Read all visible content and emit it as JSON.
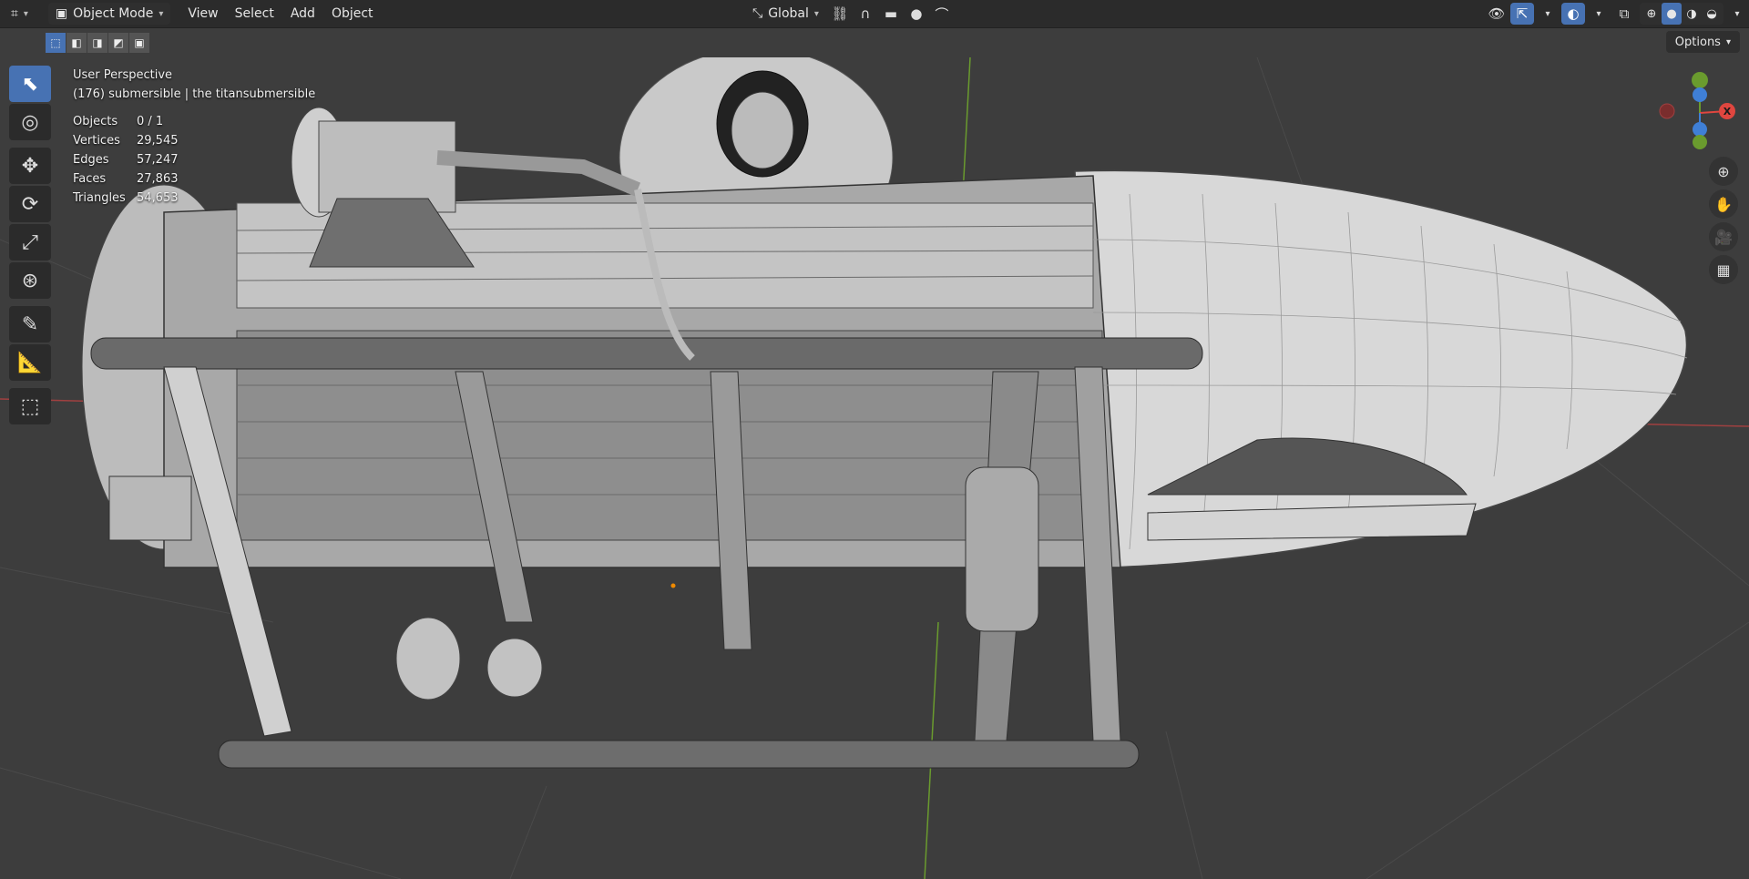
{
  "header": {
    "editor_icon": "editor-type-icon",
    "mode_label": "Object Mode",
    "menus": [
      "View",
      "Select",
      "Add",
      "Object"
    ],
    "transform_orientation": "Global"
  },
  "subbar": {
    "options_label": "Options"
  },
  "viewport": {
    "view_name": "User Perspective",
    "object_info": "(176) submersible | the titansubmersible",
    "stats": [
      {
        "label": "Objects",
        "value": "0 / 1"
      },
      {
        "label": "Vertices",
        "value": "29,545"
      },
      {
        "label": "Edges",
        "value": "57,247"
      },
      {
        "label": "Faces",
        "value": "27,863"
      },
      {
        "label": "Triangles",
        "value": "54,653"
      }
    ]
  },
  "gizmo": {
    "x_label": "X",
    "x_color": "#e0463f",
    "y_color": "#6a9b2e",
    "z_color": "#3f7fd6"
  },
  "toolbar": {
    "tools": [
      "select-box-icon",
      "cursor-icon",
      "move-icon",
      "rotate-icon",
      "scale-icon",
      "transform-icon",
      "annotate-icon",
      "measure-icon",
      "add-cube-icon"
    ]
  },
  "nav": {
    "tools": [
      "zoom-icon",
      "pan-hand-icon",
      "camera-icon",
      "grid-view-icon"
    ]
  },
  "colors": {
    "accent": "#4772b3",
    "header_bg": "#2b2b2b",
    "viewport_bg": "#3d3d3d"
  }
}
